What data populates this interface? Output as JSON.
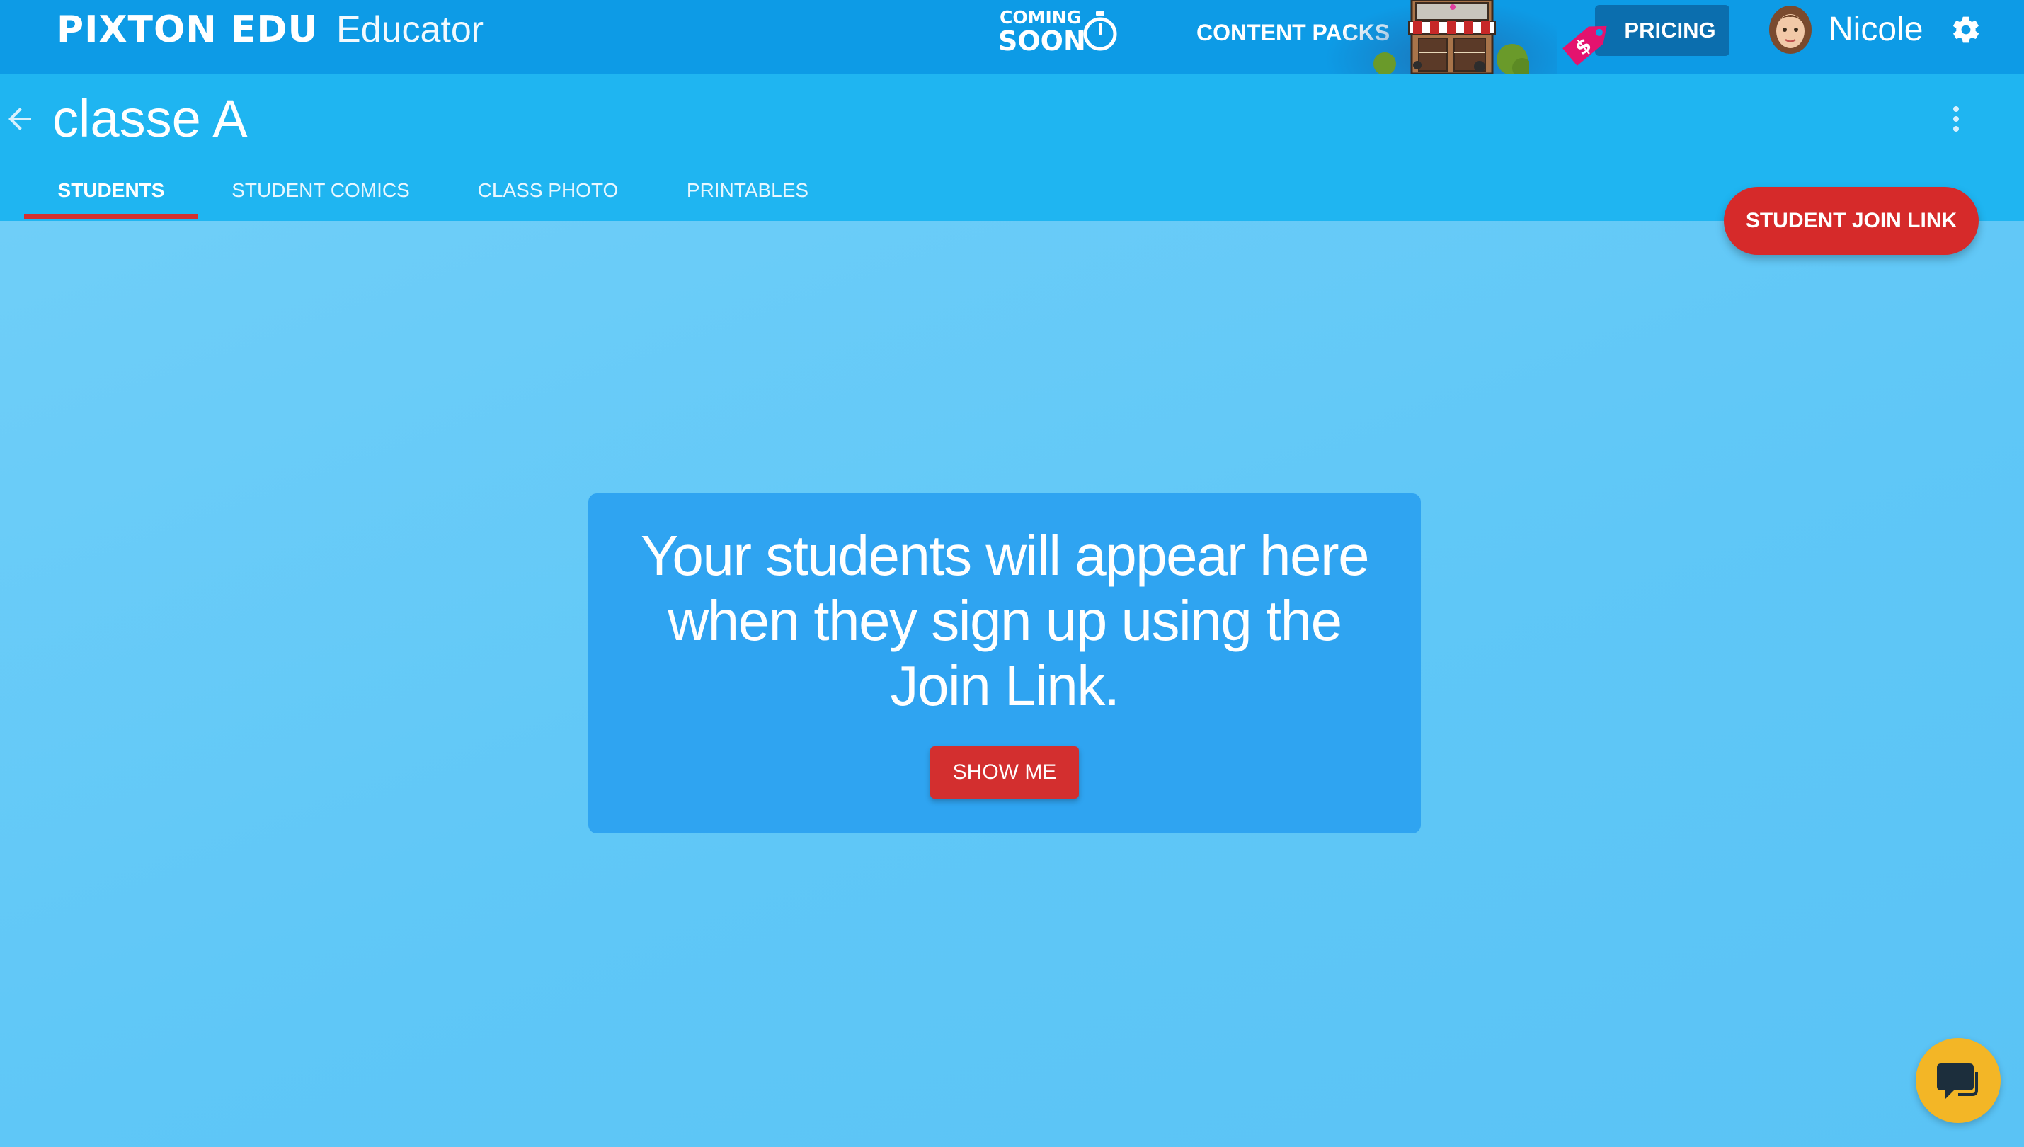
{
  "topbar": {
    "brand": "PIXTON EDU",
    "role": "Educator",
    "coming_soon_line1": "COMING",
    "coming_soon_line2": "SOON",
    "content_packs": "CONTENT PACKS",
    "pricing": "PRICING",
    "user_name": "Nicole"
  },
  "class": {
    "title": "classe A",
    "tabs": [
      {
        "label": "STUDENTS",
        "active": true
      },
      {
        "label": "STUDENT COMICS",
        "active": false
      },
      {
        "label": "CLASS PHOTO",
        "active": false
      },
      {
        "label": "PRINTABLES",
        "active": false
      }
    ],
    "join_link_label": "STUDENT JOIN LINK"
  },
  "empty_state": {
    "message": "Your students will appear here when they sign up using the Join Link.",
    "button_label": "SHOW ME"
  },
  "colors": {
    "topbar": "#0d9be6",
    "classbar": "#1fb5f1",
    "background": "#65c9f7",
    "card": "#2fa4f1",
    "accent_red": "#d32f2f",
    "chat_yellow": "#f3b626"
  },
  "icons": [
    "timer-icon",
    "shop-icon",
    "price-tag-icon",
    "avatar",
    "gear-icon",
    "back-arrow-icon",
    "more-vert-icon",
    "chat-icon"
  ]
}
